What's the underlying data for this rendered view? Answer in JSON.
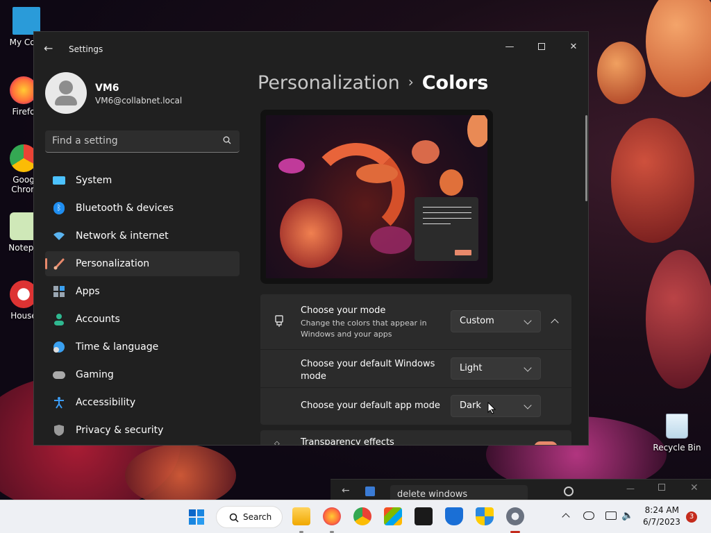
{
  "desktop": {
    "icons": [
      {
        "label": "My Com",
        "color": "#2a9bd9"
      },
      {
        "label": "Firefo",
        "color": "#ff7139"
      },
      {
        "label": "Goog Chron",
        "color": "#34a853"
      },
      {
        "label": "Notepa",
        "color": "#9ccf8a"
      },
      {
        "label": "House",
        "color": "#d33"
      }
    ],
    "recycle_bin_label": "Recycle Bin"
  },
  "settings": {
    "window_title": "Settings",
    "user": {
      "name": "VM6",
      "email": "VM6@collabnet.local"
    },
    "search_placeholder": "Find a setting",
    "nav": [
      {
        "label": "System",
        "icon": "monitor-icon",
        "color": "#4cc2ff"
      },
      {
        "label": "Bluetooth & devices",
        "icon": "bluetooth-icon",
        "color": "#1f8ef1"
      },
      {
        "label": "Network & internet",
        "icon": "wifi-icon",
        "color": "#5bb4f0"
      },
      {
        "label": "Personalization",
        "icon": "brush-icon",
        "color": "#e8896b",
        "active": true
      },
      {
        "label": "Apps",
        "icon": "apps-icon",
        "color": "#9aa6b2"
      },
      {
        "label": "Accounts",
        "icon": "person-icon",
        "color": "#2fb890"
      },
      {
        "label": "Time & language",
        "icon": "globe-clock-icon",
        "color": "#3aa0f0"
      },
      {
        "label": "Gaming",
        "icon": "gamepad-icon",
        "color": "#aaaaaa"
      },
      {
        "label": "Accessibility",
        "icon": "accessibility-icon",
        "color": "#3b9cf5"
      },
      {
        "label": "Privacy & security",
        "icon": "shield-icon",
        "color": "#9a9a9a"
      }
    ],
    "breadcrumb": {
      "parent": "Personalization",
      "separator": "›",
      "current": "Colors"
    },
    "mode": {
      "title": "Choose your mode",
      "subtitle": "Change the colors that appear in Windows and your apps",
      "value": "Custom"
    },
    "windows_mode": {
      "title": "Choose your default Windows mode",
      "value": "Light"
    },
    "app_mode": {
      "title": "Choose your default app mode",
      "value": "Dark"
    },
    "transparency": {
      "title": "Transparency effects"
    }
  },
  "background_window": {
    "search_text": "delete windows"
  },
  "taskbar": {
    "search_label": "Search",
    "time": "8:24 AM",
    "date": "6/7/2023",
    "notification_count": "3"
  },
  "colors": {
    "accent": "#e8896b",
    "window_bg": "#202020",
    "card_bg": "#2b2b2b"
  }
}
